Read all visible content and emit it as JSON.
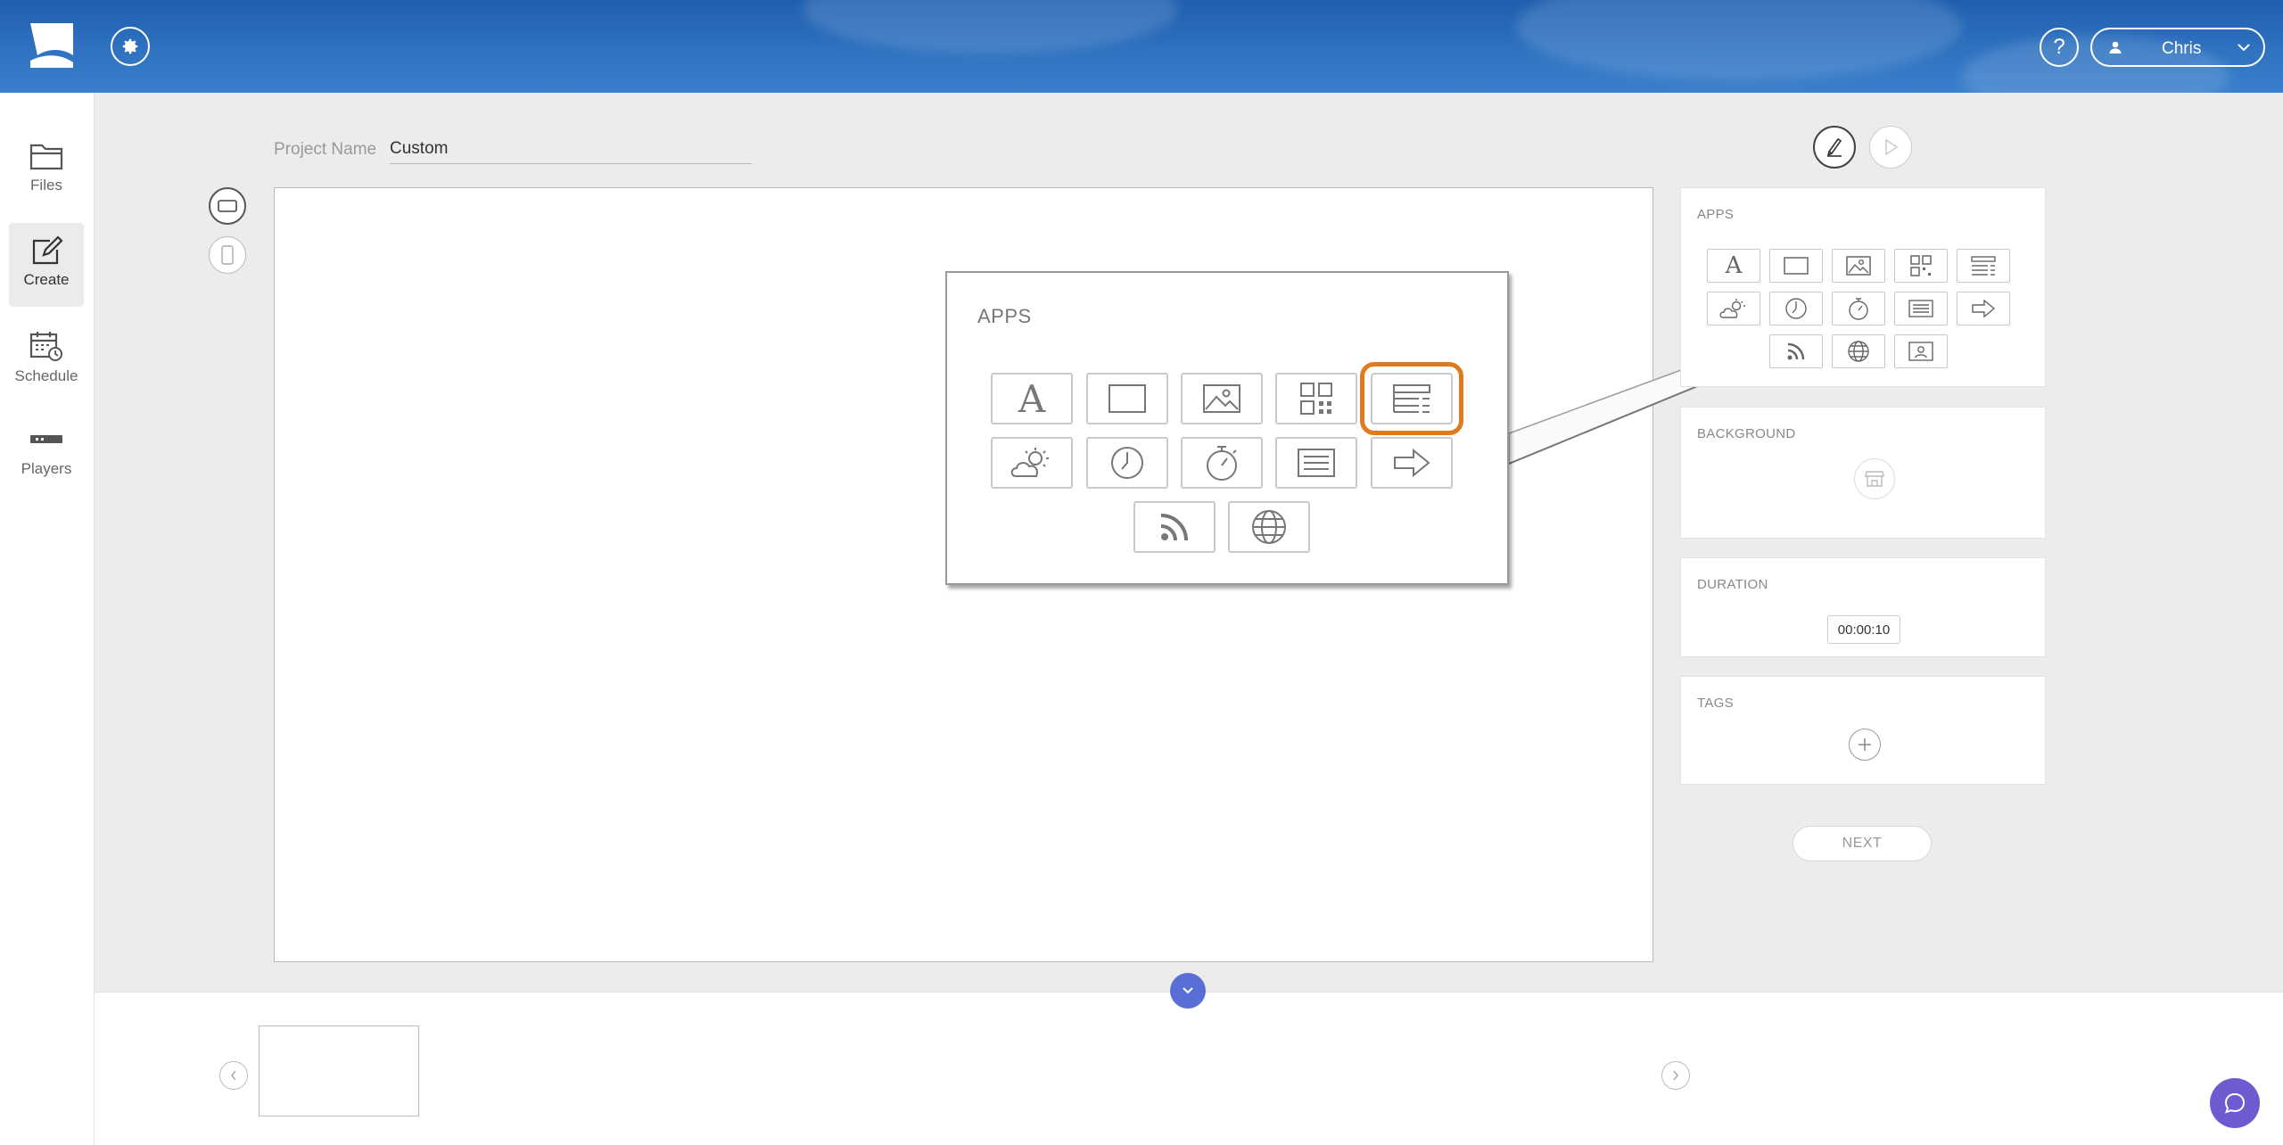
{
  "header": {
    "user_name": "Chris",
    "help_label": "?"
  },
  "nav": {
    "items": [
      {
        "label": "Files",
        "icon": "folder-icon"
      },
      {
        "label": "Create",
        "icon": "create-icon",
        "active": true
      },
      {
        "label": "Schedule",
        "icon": "calendar-icon"
      },
      {
        "label": "Players",
        "icon": "player-icon"
      }
    ]
  },
  "project": {
    "label": "Project Name",
    "value": "Custom"
  },
  "callout": {
    "title": "APPS",
    "highlighted_tile": "ticker-list-icon",
    "accent": "#e07a1f"
  },
  "panels": {
    "apps_title": "APPS",
    "background_title": "BACKGROUND",
    "duration_title": "DURATION",
    "duration_value": "00:00:10",
    "tags_title": "TAGS"
  },
  "actions": {
    "next_label": "NEXT"
  },
  "colors": {
    "header_blue": "#2e72c0",
    "collapse_button": "#5a6fd6",
    "chat_button": "#6d5bd0"
  }
}
